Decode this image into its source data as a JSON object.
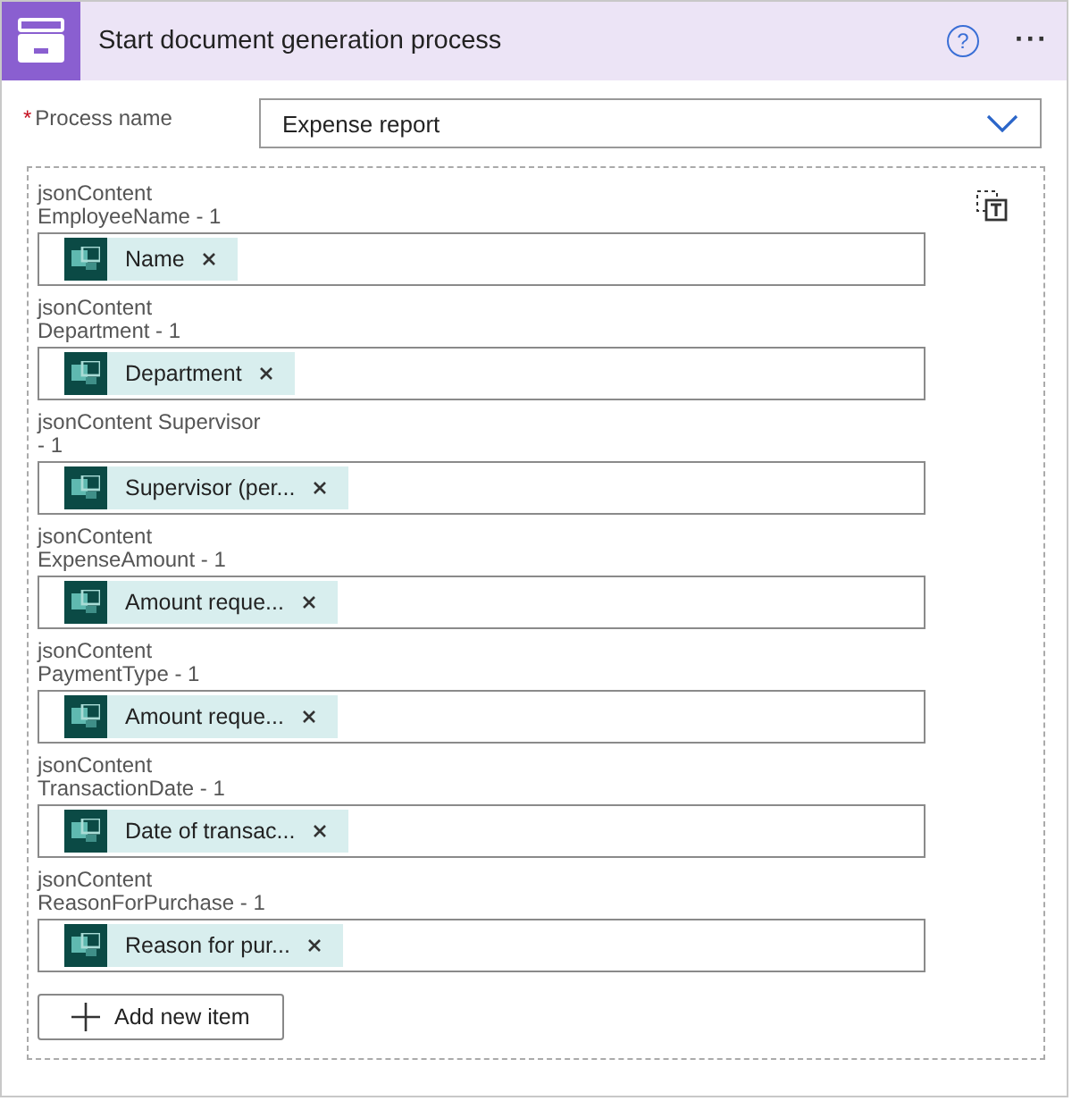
{
  "header": {
    "title": "Start document generation process",
    "help": "?",
    "more": "···"
  },
  "process": {
    "required_marker": "*",
    "label": "Process name",
    "value": "Expense report"
  },
  "items": [
    {
      "label": "jsonContent EmployeeName - 1",
      "token": "Name"
    },
    {
      "label": "jsonContent Department - 1",
      "token": "Department"
    },
    {
      "label": "jsonContent Supervisor - 1",
      "token": "Supervisor (per..."
    },
    {
      "label": "jsonContent ExpenseAmount - 1",
      "token": "Amount reque..."
    },
    {
      "label": "jsonContent PaymentType - 1",
      "token": "Amount reque..."
    },
    {
      "label": "jsonContent TransactionDate - 1",
      "token": "Date of transac..."
    },
    {
      "label": "jsonContent ReasonForPurchase - 1",
      "token": "Reason for pur..."
    }
  ],
  "add_button": "Add new item"
}
